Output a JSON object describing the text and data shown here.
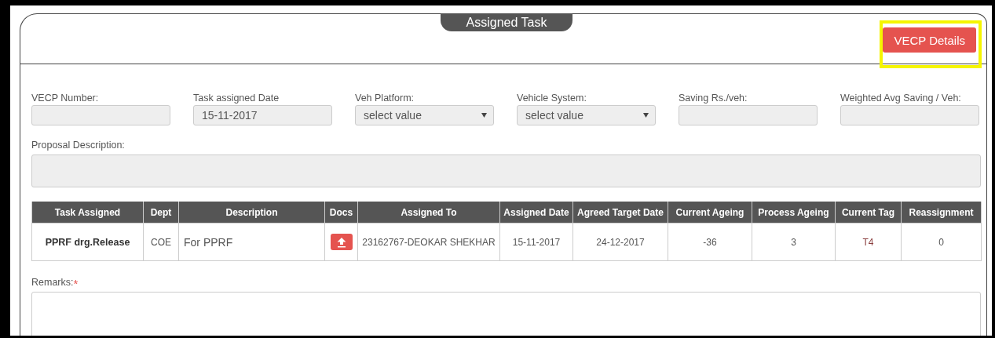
{
  "panel": {
    "title": "Assigned Task"
  },
  "header_button": {
    "label": "VECP Details",
    "highlighted": true
  },
  "fields": [
    {
      "kind": "text",
      "label": "VECP Number:"
    },
    {
      "kind": "text",
      "label": "Task assigned Date",
      "value": "15-11-2017"
    },
    {
      "kind": "select",
      "label": "Veh Platform:",
      "value": "select value"
    },
    {
      "kind": "select",
      "label": "Vehicle System:",
      "value": "select value"
    },
    {
      "kind": "text",
      "label": "Saving Rs./veh:"
    },
    {
      "kind": "text",
      "label": "Weighted Avg Saving / Veh:"
    }
  ],
  "proposal": {
    "label": "Proposal Description:"
  },
  "table": {
    "columns": [
      "Task Assigned",
      "Dept",
      "Description",
      "Docs",
      "Assigned To",
      "Assigned Date",
      "Agreed Target Date",
      "Current Ageing",
      "Process Ageing",
      "Current Tag",
      "Reassignment"
    ],
    "rows": [
      {
        "cells": [
          {
            "kind": "bold",
            "text": "PPRF drg.Release"
          },
          {
            "kind": "text",
            "text": "COE"
          },
          {
            "kind": "large",
            "text": "For PPRF"
          },
          {
            "kind": "upload"
          },
          {
            "kind": "text",
            "text": "23162767-DEOKAR SHEKHAR"
          },
          {
            "kind": "text",
            "text": "15-11-2017"
          },
          {
            "kind": "text",
            "text": "24-12-2017"
          },
          {
            "kind": "text",
            "text": "-36"
          },
          {
            "kind": "text",
            "text": "3"
          },
          {
            "kind": "tag",
            "text": "T4"
          },
          {
            "kind": "text",
            "text": "0"
          }
        ]
      }
    ]
  },
  "remarks": {
    "label": "Remarks:",
    "required_mark": "*"
  }
}
